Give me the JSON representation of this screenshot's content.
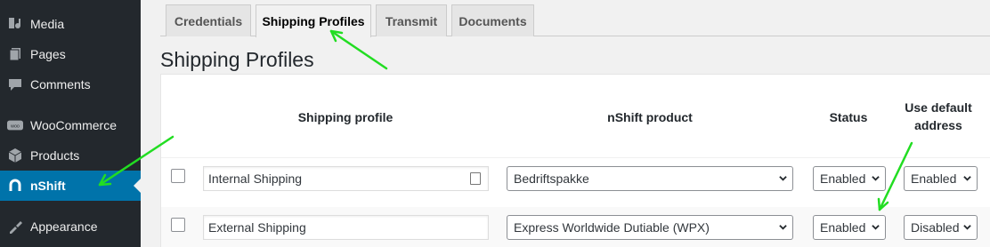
{
  "sidebar": {
    "items": [
      {
        "label": "Media",
        "icon": "media-icon"
      },
      {
        "label": "Pages",
        "icon": "pages-icon"
      },
      {
        "label": "Comments",
        "icon": "comments-icon"
      },
      {
        "label": "WooCommerce",
        "icon": "woocommerce-icon"
      },
      {
        "label": "Products",
        "icon": "products-icon"
      },
      {
        "label": "nShift",
        "icon": "nshift-icon",
        "active": true
      },
      {
        "label": "Appearance",
        "icon": "appearance-icon"
      }
    ]
  },
  "tabs": [
    {
      "label": "Credentials"
    },
    {
      "label": "Shipping Profiles",
      "active": true
    },
    {
      "label": "Transmit"
    },
    {
      "label": "Documents"
    }
  ],
  "page": {
    "title": "Shipping Profiles"
  },
  "table": {
    "headers": {
      "profile": "Shipping profile",
      "product": "nShift product",
      "status": "Status",
      "default_address_1": "Use default",
      "default_address_2": "address"
    },
    "rows": [
      {
        "profile": "Internal Shipping",
        "product": "Bedriftspakke",
        "status": "Enabled",
        "default_address": "Enabled"
      },
      {
        "profile": "External Shipping",
        "product": "Express Worldwide Dutiable (WPX)",
        "status": "Enabled",
        "default_address": "Disabled"
      }
    ]
  },
  "colors": {
    "sidebar_bg": "#23282d",
    "active_menu": "#0073aa",
    "annotation_arrow": "#22dd22"
  }
}
